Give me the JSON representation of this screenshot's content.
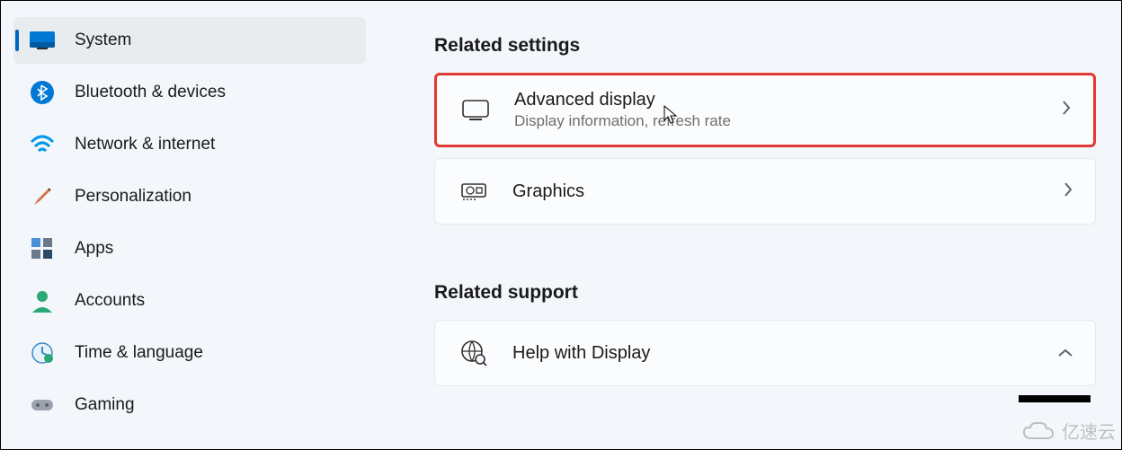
{
  "sidebar": {
    "items": [
      {
        "label": "System"
      },
      {
        "label": "Bluetooth & devices"
      },
      {
        "label": "Network & internet"
      },
      {
        "label": "Personalization"
      },
      {
        "label": "Apps"
      },
      {
        "label": "Accounts"
      },
      {
        "label": "Time & language"
      },
      {
        "label": "Gaming"
      }
    ]
  },
  "main": {
    "related_settings_heading": "Related settings",
    "advanced_display": {
      "title": "Advanced display",
      "subtitle": "Display information, refresh rate"
    },
    "graphics": {
      "title": "Graphics"
    },
    "related_support_heading": "Related support",
    "help_with_display": {
      "title": "Help with Display"
    }
  },
  "watermark": {
    "text": "亿速云"
  }
}
